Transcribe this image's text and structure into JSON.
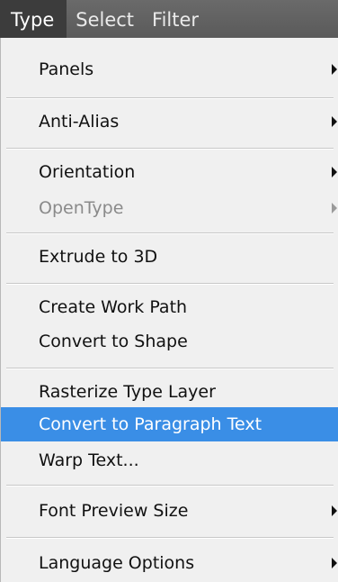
{
  "menubar": {
    "items": [
      "Type",
      "Select",
      "Filter"
    ]
  },
  "menu": {
    "items": [
      {
        "label": "Panels"
      },
      {
        "label": "Anti-Alias"
      },
      {
        "label": "Orientation"
      },
      {
        "label": "OpenType"
      },
      {
        "label": "Extrude to 3D"
      },
      {
        "label": "Create Work Path"
      },
      {
        "label": "Convert to Shape"
      },
      {
        "label": "Rasterize Type Layer"
      },
      {
        "label": "Convert to Paragraph Text"
      },
      {
        "label": "Warp Text..."
      },
      {
        "label": "Font Preview Size"
      },
      {
        "label": "Language Options"
      }
    ]
  },
  "colors": {
    "highlight": "#3a8ee6",
    "menubar": "#5e5e5e",
    "menubar_active": "#3c3c3c"
  }
}
